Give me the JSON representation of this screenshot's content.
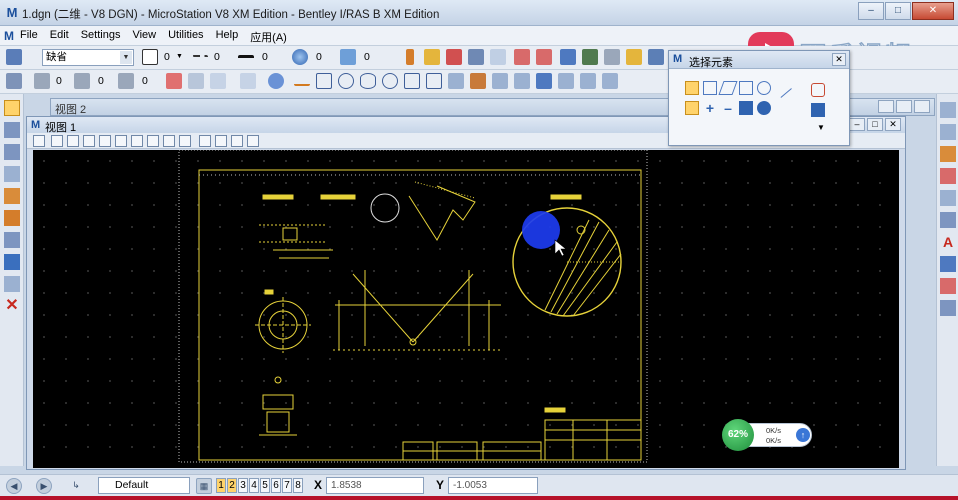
{
  "window": {
    "title": "1.dgn (二维 - V8 DGN) - MicroStation V8 XM Edition - Bentley I/RAS B XM Edition",
    "app_icon": "microstation-icon"
  },
  "menu": [
    "File",
    "Edit",
    "Settings",
    "View",
    "Utilities",
    "Help",
    "应用(A)"
  ],
  "toolbar1": {
    "level_combo": "缺省",
    "color_value": "0",
    "style_value": "0",
    "weight_value": "0",
    "trans_value": "0",
    "prio_value": "0"
  },
  "toolbar2": {
    "val_a": "0",
    "val_b": "0",
    "val_c": "0"
  },
  "views": {
    "view2_title": "视图 2",
    "view1_title": "视图 1"
  },
  "dialog": {
    "title": "选择元素"
  },
  "watermark": {
    "text": "西瓜视频"
  },
  "net_widget": {
    "percent": "62%",
    "up": "0K/s",
    "down": "0K/s"
  },
  "status": {
    "level_name": "Default",
    "view_numbers": [
      "1",
      "2",
      "3",
      "4",
      "5",
      "6",
      "7",
      "8"
    ],
    "active_views": [
      "1",
      "2"
    ],
    "x_label": "X",
    "x_value": "1.8538",
    "y_label": "Y",
    "y_value": "-1.0053"
  },
  "colors": {
    "canvas": "#000000",
    "drawing": "#e6d23a",
    "frame_white": "#dddddd",
    "cursor_highlight": "#1d3cf0"
  }
}
